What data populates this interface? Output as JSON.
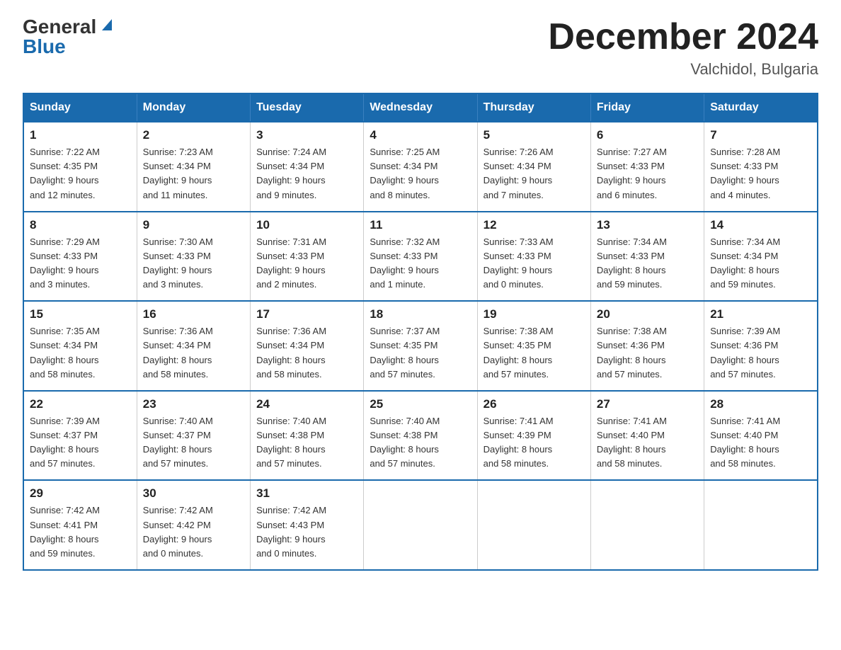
{
  "logo": {
    "general": "General",
    "blue": "Blue"
  },
  "title": {
    "month_year": "December 2024",
    "location": "Valchidol, Bulgaria"
  },
  "days_of_week": [
    "Sunday",
    "Monday",
    "Tuesday",
    "Wednesday",
    "Thursday",
    "Friday",
    "Saturday"
  ],
  "weeks": [
    [
      {
        "day": "1",
        "sunrise": "7:22 AM",
        "sunset": "4:35 PM",
        "daylight": "9 hours and 12 minutes."
      },
      {
        "day": "2",
        "sunrise": "7:23 AM",
        "sunset": "4:34 PM",
        "daylight": "9 hours and 11 minutes."
      },
      {
        "day": "3",
        "sunrise": "7:24 AM",
        "sunset": "4:34 PM",
        "daylight": "9 hours and 9 minutes."
      },
      {
        "day": "4",
        "sunrise": "7:25 AM",
        "sunset": "4:34 PM",
        "daylight": "9 hours and 8 minutes."
      },
      {
        "day": "5",
        "sunrise": "7:26 AM",
        "sunset": "4:34 PM",
        "daylight": "9 hours and 7 minutes."
      },
      {
        "day": "6",
        "sunrise": "7:27 AM",
        "sunset": "4:33 PM",
        "daylight": "9 hours and 6 minutes."
      },
      {
        "day": "7",
        "sunrise": "7:28 AM",
        "sunset": "4:33 PM",
        "daylight": "9 hours and 4 minutes."
      }
    ],
    [
      {
        "day": "8",
        "sunrise": "7:29 AM",
        "sunset": "4:33 PM",
        "daylight": "9 hours and 3 minutes."
      },
      {
        "day": "9",
        "sunrise": "7:30 AM",
        "sunset": "4:33 PM",
        "daylight": "9 hours and 3 minutes."
      },
      {
        "day": "10",
        "sunrise": "7:31 AM",
        "sunset": "4:33 PM",
        "daylight": "9 hours and 2 minutes."
      },
      {
        "day": "11",
        "sunrise": "7:32 AM",
        "sunset": "4:33 PM",
        "daylight": "9 hours and 1 minute."
      },
      {
        "day": "12",
        "sunrise": "7:33 AM",
        "sunset": "4:33 PM",
        "daylight": "9 hours and 0 minutes."
      },
      {
        "day": "13",
        "sunrise": "7:34 AM",
        "sunset": "4:33 PM",
        "daylight": "8 hours and 59 minutes."
      },
      {
        "day": "14",
        "sunrise": "7:34 AM",
        "sunset": "4:34 PM",
        "daylight": "8 hours and 59 minutes."
      }
    ],
    [
      {
        "day": "15",
        "sunrise": "7:35 AM",
        "sunset": "4:34 PM",
        "daylight": "8 hours and 58 minutes."
      },
      {
        "day": "16",
        "sunrise": "7:36 AM",
        "sunset": "4:34 PM",
        "daylight": "8 hours and 58 minutes."
      },
      {
        "day": "17",
        "sunrise": "7:36 AM",
        "sunset": "4:34 PM",
        "daylight": "8 hours and 58 minutes."
      },
      {
        "day": "18",
        "sunrise": "7:37 AM",
        "sunset": "4:35 PM",
        "daylight": "8 hours and 57 minutes."
      },
      {
        "day": "19",
        "sunrise": "7:38 AM",
        "sunset": "4:35 PM",
        "daylight": "8 hours and 57 minutes."
      },
      {
        "day": "20",
        "sunrise": "7:38 AM",
        "sunset": "4:36 PM",
        "daylight": "8 hours and 57 minutes."
      },
      {
        "day": "21",
        "sunrise": "7:39 AM",
        "sunset": "4:36 PM",
        "daylight": "8 hours and 57 minutes."
      }
    ],
    [
      {
        "day": "22",
        "sunrise": "7:39 AM",
        "sunset": "4:37 PM",
        "daylight": "8 hours and 57 minutes."
      },
      {
        "day": "23",
        "sunrise": "7:40 AM",
        "sunset": "4:37 PM",
        "daylight": "8 hours and 57 minutes."
      },
      {
        "day": "24",
        "sunrise": "7:40 AM",
        "sunset": "4:38 PM",
        "daylight": "8 hours and 57 minutes."
      },
      {
        "day": "25",
        "sunrise": "7:40 AM",
        "sunset": "4:38 PM",
        "daylight": "8 hours and 57 minutes."
      },
      {
        "day": "26",
        "sunrise": "7:41 AM",
        "sunset": "4:39 PM",
        "daylight": "8 hours and 58 minutes."
      },
      {
        "day": "27",
        "sunrise": "7:41 AM",
        "sunset": "4:40 PM",
        "daylight": "8 hours and 58 minutes."
      },
      {
        "day": "28",
        "sunrise": "7:41 AM",
        "sunset": "4:40 PM",
        "daylight": "8 hours and 58 minutes."
      }
    ],
    [
      {
        "day": "29",
        "sunrise": "7:42 AM",
        "sunset": "4:41 PM",
        "daylight": "8 hours and 59 minutes."
      },
      {
        "day": "30",
        "sunrise": "7:42 AM",
        "sunset": "4:42 PM",
        "daylight": "9 hours and 0 minutes."
      },
      {
        "day": "31",
        "sunrise": "7:42 AM",
        "sunset": "4:43 PM",
        "daylight": "9 hours and 0 minutes."
      },
      null,
      null,
      null,
      null
    ]
  ],
  "labels": {
    "sunrise": "Sunrise:",
    "sunset": "Sunset:",
    "daylight": "Daylight:"
  }
}
